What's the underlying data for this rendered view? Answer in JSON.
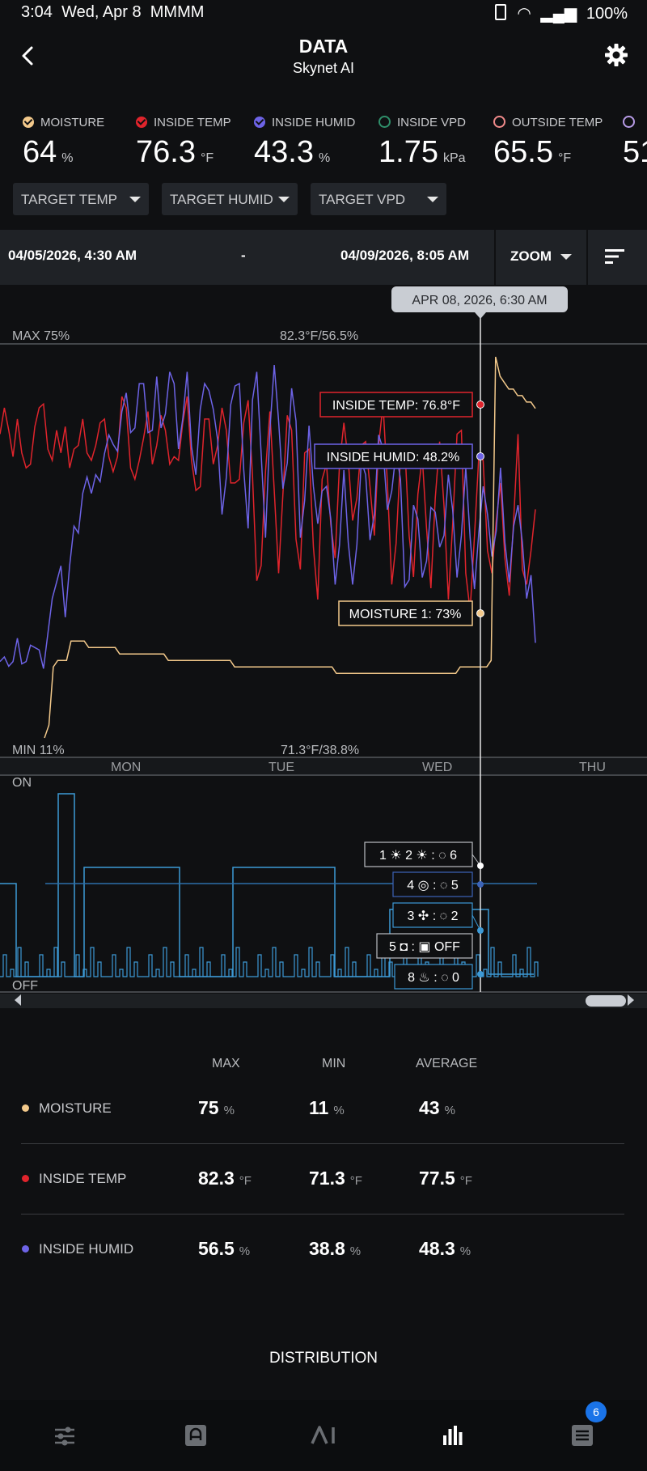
{
  "status_bar": {
    "time": "3:04",
    "date": "Wed, Apr 8",
    "notif": "MMMM",
    "battery": "100%"
  },
  "header": {
    "title": "DATA",
    "subtitle": "Skynet AI"
  },
  "metrics": [
    {
      "label": "MOISTURE",
      "value": "64",
      "unit": "%",
      "color": "#f3c98b",
      "checked": true
    },
    {
      "label": "INSIDE TEMP",
      "value": "76.3",
      "unit": "°F",
      "color": "#e0242c",
      "checked": true
    },
    {
      "label": "INSIDE HUMID",
      "value": "43.3",
      "unit": "%",
      "color": "#6d63e6",
      "checked": true
    },
    {
      "label": "INSIDE VPD",
      "value": "1.75",
      "unit": "kPa",
      "color": "#2f8f6a",
      "checked": false
    },
    {
      "label": "OUTSIDE TEMP",
      "value": "65.5",
      "unit": "°F",
      "color": "#f08a8a",
      "checked": false
    },
    {
      "label": "",
      "value": "51",
      "unit": "",
      "color": "#b79be6",
      "checked": false
    }
  ],
  "dropdowns": [
    "TARGET TEMP",
    "TARGET HUMID",
    "TARGET VPD"
  ],
  "range": {
    "start": "04/05/2026, 4:30 AM",
    "separator": "-",
    "end": "04/09/2026, 8:05 AM",
    "zoom_label": "ZOOM"
  },
  "chart_data": {
    "type": "line",
    "cursor_label": "APR 08, 2026, 6:30 AM",
    "max_label": "MAX 75%",
    "max_center_label": "82.3°F/56.5%",
    "min_label": "MIN 11%",
    "min_center_label": "71.3°F/38.8%",
    "day_labels": [
      "MON",
      "TUE",
      "WED",
      "THU"
    ],
    "on_label": "ON",
    "off_label": "OFF",
    "tooltips": {
      "inside_temp": "INSIDE TEMP: 76.8°F",
      "inside_humid": "INSIDE HUMID: 48.2%",
      "moisture": "MOISTURE 1: 73%"
    },
    "device_labels": [
      "1 ☀ 2 ☀ : ◌ 6",
      "4 ◎ : ◌ 5",
      "3 ✣ : ◌ 2",
      "5 ◘ : ▣ OFF",
      "8 ♨ : ◌ 0"
    ],
    "series": [
      {
        "name": "INSIDE TEMP",
        "color": "#e0242c",
        "values": [
          79.9,
          80.6,
          80.0,
          79.3,
          80.3,
          79.4,
          79.0,
          79.1,
          80.1,
          80.6,
          80.7,
          79.5,
          79.2,
          80.0,
          79.4,
          80.1,
          79.0,
          79.5,
          79.6,
          80.3,
          79.4,
          79.2,
          79.6,
          80.2,
          80.3,
          79.3,
          78.9,
          79.3,
          80.9,
          80.6,
          79.0,
          78.7,
          79.2,
          79.8,
          80.5,
          79.1,
          79.6,
          80.4,
          80.0,
          79.1,
          79.3,
          79.2,
          80.2,
          80.9,
          79.2,
          78.4,
          78.5,
          80.3,
          80.3,
          79.1,
          79.6,
          80.6,
          80.0,
          78.6,
          78.6,
          78.7,
          80.2,
          80.8,
          78.8,
          76.0,
          76.4,
          78.9,
          80.5,
          78.4,
          76.2,
          78.3,
          80.4,
          80.0,
          77.1,
          76.3,
          79.4,
          79.5,
          76.9,
          75.5,
          78.7,
          79.1,
          77.5,
          76.6,
          79.1,
          80.2,
          79.2,
          77.6,
          78.2,
          79.6,
          79.7,
          78.5,
          77.2,
          79.6,
          80.7,
          78.6,
          75.9,
          77.0,
          79.3,
          79.6,
          77.2,
          76.1,
          78.3,
          79.3,
          77.4,
          75.8,
          78.2,
          79.7,
          78.0,
          75.5,
          77.5,
          79.9,
          80.0,
          76.2,
          75.2,
          77.2,
          79.3,
          79.2,
          76.8,
          76.2,
          77.6,
          78.6,
          76.6,
          75.6,
          77.6,
          79.9,
          76.3,
          75.9,
          76.8,
          77.9
        ]
      },
      {
        "name": "INSIDE HUMID",
        "color": "#6d63e6",
        "values": [
          42.9,
          43.1,
          42.7,
          42.9,
          43.9,
          42.8,
          42.9,
          43.6,
          43.5,
          43.4,
          42.6,
          44.1,
          45.6,
          46.3,
          47.0,
          44.8,
          47.0,
          48.7,
          48.4,
          50.1,
          50.8,
          50.1,
          50.9,
          50.6,
          51.8,
          52.6,
          52.2,
          51.9,
          53.6,
          54.4,
          52.7,
          52.9,
          54.8,
          54.8,
          52.7,
          52.8,
          55.1,
          52.9,
          53.5,
          55.3,
          54.8,
          52.0,
          53.3,
          55.3,
          52.1,
          50.9,
          53.7,
          54.8,
          54.5,
          53.7,
          52.4,
          49.2,
          50.8,
          53.9,
          54.7,
          54.8,
          51.1,
          48.6,
          54.1,
          55.3,
          51.8,
          48.2,
          52.8,
          55.6,
          53.2,
          50.3,
          51.4,
          54.6,
          53.2,
          48.2,
          49.8,
          53.0,
          50.4,
          48.8,
          50.2,
          50.4,
          49.0,
          46.2,
          47.9,
          51.1,
          48.0,
          46.2,
          47.9,
          51.5,
          50.9,
          48.1,
          49.2,
          52.6,
          52.0,
          49.4,
          50.2,
          51.9,
          50.7,
          46.1,
          46.4,
          49.6,
          49.0,
          46.5,
          47.2,
          49.5,
          49.3,
          47.8,
          48.3,
          50.9,
          49.4,
          46.5,
          48.3,
          51.2,
          48.2,
          46.0,
          48.4,
          50.4,
          49.2,
          47.4,
          48.5,
          51.2,
          48.0,
          46.3,
          48.7,
          49.6,
          48.0,
          45.6,
          46.6,
          43.7
        ]
      },
      {
        "name": "MOISTURE",
        "color": "#f3c98b",
        "values": [
          14,
          16,
          25,
          26,
          26,
          26,
          29,
          29,
          29,
          29,
          28,
          28,
          28,
          28,
          28,
          28,
          28,
          27,
          27,
          27,
          27,
          27,
          27,
          27,
          27,
          27,
          27,
          27,
          26,
          26,
          26,
          26,
          26,
          26,
          26,
          26,
          26,
          26,
          26,
          26,
          26,
          26,
          26,
          25,
          25,
          25,
          25,
          25,
          25,
          25,
          25,
          25,
          25,
          25,
          25,
          25,
          25,
          25,
          25,
          25,
          25,
          25,
          25,
          25,
          25,
          25,
          24,
          24,
          24,
          24,
          24,
          24,
          24,
          24,
          24,
          24,
          24,
          24,
          24,
          24,
          24,
          24,
          24,
          24,
          24,
          24,
          24,
          24,
          24,
          24,
          24,
          24,
          24,
          24,
          25,
          25,
          25,
          25,
          25,
          25,
          25,
          26,
          73,
          70,
          69,
          68,
          68,
          67,
          67,
          66,
          66,
          65
        ]
      }
    ]
  },
  "stats": {
    "headers": [
      "MAX",
      "MIN",
      "AVERAGE"
    ],
    "rows": [
      {
        "name": "MOISTURE",
        "color": "#f3c98b",
        "max": "75",
        "min": "11",
        "avg": "43",
        "unit": "%"
      },
      {
        "name": "INSIDE TEMP",
        "color": "#e0242c",
        "max": "82.3",
        "min": "71.3",
        "avg": "77.5",
        "unit": "°F"
      },
      {
        "name": "INSIDE HUMID",
        "color": "#6d63e6",
        "max": "56.5",
        "min": "38.8",
        "avg": "48.3",
        "unit": "%"
      }
    ]
  },
  "distribution_label": "DISTRIBUTION",
  "bottom_nav": {
    "badge": "6",
    "icons": [
      "sliders-icon",
      "controller-icon",
      "ai-icon",
      "data-chart-icon",
      "list-icon"
    ],
    "active": "data-chart-icon"
  }
}
